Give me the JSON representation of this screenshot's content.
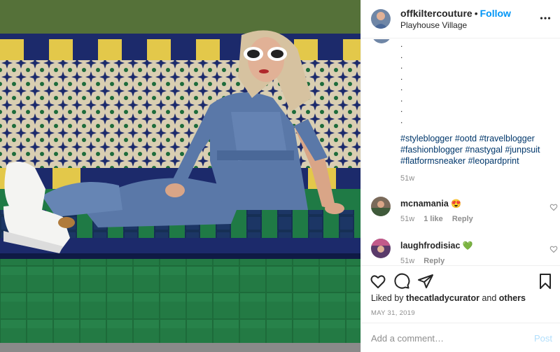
{
  "post": {
    "photo": {
      "alt": "Woman in a denim jumpsuit and white sunglasses sitting on a tiled bench",
      "colors": {
        "navy_tile": "#1c2a6b",
        "yellow_tile": "#e3c84a",
        "green_tile": "#1d6b3a",
        "denim": "#5a78a8",
        "sky_hedge": "#4f6b36"
      }
    },
    "header": {
      "username": "offkiltercouture",
      "follow_label": "Follow",
      "location": "Playhouse Village",
      "more_icon": "more-horizontal-icon"
    },
    "caption": {
      "dots": [
        ".",
        ".",
        ".",
        ".",
        ".",
        ".",
        ".",
        ".",
        "."
      ],
      "hashtags": [
        "#styleblogger",
        "#ootd",
        "#travelblogger",
        "#fashionblogger",
        "#nastygal",
        "#junpsuit",
        "#flatformsneaker",
        "#leopardprint"
      ],
      "time": "51w"
    },
    "comments": [
      {
        "username": "mcnamania",
        "emoji": "😍",
        "time": "51w",
        "likes": "1 like",
        "reply": "Reply"
      },
      {
        "username": "laughfrodisiac",
        "emoji": "💚",
        "time": "51w",
        "likes": "",
        "reply": "Reply"
      }
    ],
    "actions": {
      "icons": [
        "heart-icon",
        "comment-icon",
        "share-icon",
        "bookmark-icon"
      ],
      "liked_by_prefix": "Liked by",
      "liked_by_user": "thecatladycurator",
      "and_label": "and",
      "others_label": "others",
      "date": "MAY 31, 2019"
    },
    "add_comment": {
      "placeholder": "Add a comment…",
      "post_label": "Post"
    },
    "accent_color": "#0095f6"
  }
}
